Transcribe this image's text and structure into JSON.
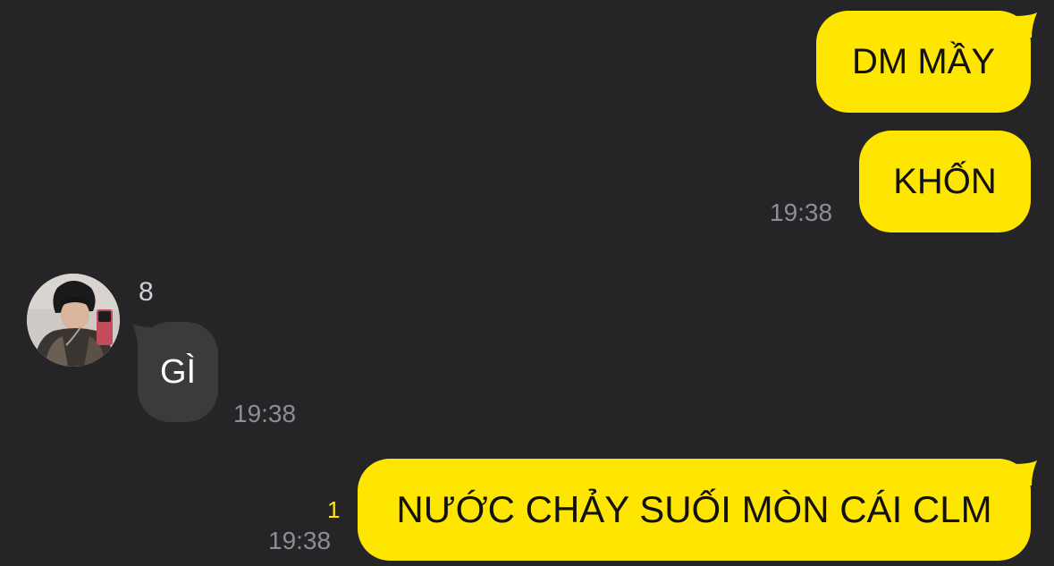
{
  "colors": {
    "background": "#252527",
    "outgoing_bubble": "#FFE600",
    "incoming_bubble": "#3b3b3e",
    "timestamp": "#8d8d92",
    "unread_count": "#FFE600"
  },
  "messages": [
    {
      "id": "m1",
      "direction": "outgoing",
      "text": "DM MẦY"
    },
    {
      "id": "m2",
      "direction": "outgoing",
      "text": "KHỐN",
      "time": "19:38"
    },
    {
      "id": "m3",
      "direction": "incoming",
      "sender": "8",
      "avatar": "user-avatar-photo",
      "text": "GÌ",
      "time": "19:38"
    },
    {
      "id": "m4",
      "direction": "outgoing",
      "text": "NƯỚC CHẢY SUỐI MÒN CÁI CLM",
      "time": "19:38",
      "unread": "1"
    }
  ]
}
